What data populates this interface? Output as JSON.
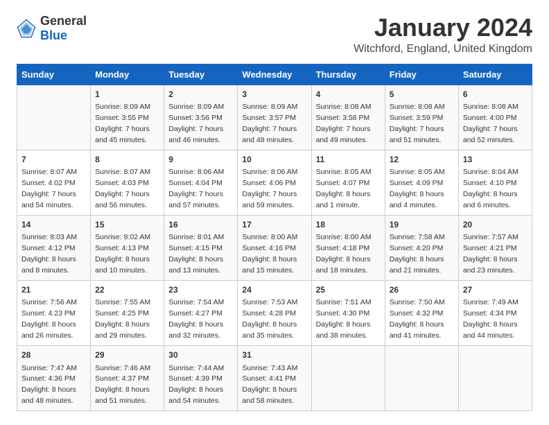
{
  "logo": {
    "general": "General",
    "blue": "Blue"
  },
  "title": "January 2024",
  "subtitle": "Witchford, England, United Kingdom",
  "days_of_week": [
    "Sunday",
    "Monday",
    "Tuesday",
    "Wednesday",
    "Thursday",
    "Friday",
    "Saturday"
  ],
  "weeks": [
    [
      {
        "day": "",
        "info": ""
      },
      {
        "day": "1",
        "info": "Sunrise: 8:09 AM\nSunset: 3:55 PM\nDaylight: 7 hours\nand 45 minutes."
      },
      {
        "day": "2",
        "info": "Sunrise: 8:09 AM\nSunset: 3:56 PM\nDaylight: 7 hours\nand 46 minutes."
      },
      {
        "day": "3",
        "info": "Sunrise: 8:09 AM\nSunset: 3:57 PM\nDaylight: 7 hours\nand 48 minutes."
      },
      {
        "day": "4",
        "info": "Sunrise: 8:08 AM\nSunset: 3:58 PM\nDaylight: 7 hours\nand 49 minutes."
      },
      {
        "day": "5",
        "info": "Sunrise: 8:08 AM\nSunset: 3:59 PM\nDaylight: 7 hours\nand 51 minutes."
      },
      {
        "day": "6",
        "info": "Sunrise: 8:08 AM\nSunset: 4:00 PM\nDaylight: 7 hours\nand 52 minutes."
      }
    ],
    [
      {
        "day": "7",
        "info": "Sunrise: 8:07 AM\nSunset: 4:02 PM\nDaylight: 7 hours\nand 54 minutes."
      },
      {
        "day": "8",
        "info": "Sunrise: 8:07 AM\nSunset: 4:03 PM\nDaylight: 7 hours\nand 56 minutes."
      },
      {
        "day": "9",
        "info": "Sunrise: 8:06 AM\nSunset: 4:04 PM\nDaylight: 7 hours\nand 57 minutes."
      },
      {
        "day": "10",
        "info": "Sunrise: 8:06 AM\nSunset: 4:06 PM\nDaylight: 7 hours\nand 59 minutes."
      },
      {
        "day": "11",
        "info": "Sunrise: 8:05 AM\nSunset: 4:07 PM\nDaylight: 8 hours\nand 1 minute."
      },
      {
        "day": "12",
        "info": "Sunrise: 8:05 AM\nSunset: 4:09 PM\nDaylight: 8 hours\nand 4 minutes."
      },
      {
        "day": "13",
        "info": "Sunrise: 8:04 AM\nSunset: 4:10 PM\nDaylight: 8 hours\nand 6 minutes."
      }
    ],
    [
      {
        "day": "14",
        "info": "Sunrise: 8:03 AM\nSunset: 4:12 PM\nDaylight: 8 hours\nand 8 minutes."
      },
      {
        "day": "15",
        "info": "Sunrise: 8:02 AM\nSunset: 4:13 PM\nDaylight: 8 hours\nand 10 minutes."
      },
      {
        "day": "16",
        "info": "Sunrise: 8:01 AM\nSunset: 4:15 PM\nDaylight: 8 hours\nand 13 minutes."
      },
      {
        "day": "17",
        "info": "Sunrise: 8:00 AM\nSunset: 4:16 PM\nDaylight: 8 hours\nand 15 minutes."
      },
      {
        "day": "18",
        "info": "Sunrise: 8:00 AM\nSunset: 4:18 PM\nDaylight: 8 hours\nand 18 minutes."
      },
      {
        "day": "19",
        "info": "Sunrise: 7:58 AM\nSunset: 4:20 PM\nDaylight: 8 hours\nand 21 minutes."
      },
      {
        "day": "20",
        "info": "Sunrise: 7:57 AM\nSunset: 4:21 PM\nDaylight: 8 hours\nand 23 minutes."
      }
    ],
    [
      {
        "day": "21",
        "info": "Sunrise: 7:56 AM\nSunset: 4:23 PM\nDaylight: 8 hours\nand 26 minutes."
      },
      {
        "day": "22",
        "info": "Sunrise: 7:55 AM\nSunset: 4:25 PM\nDaylight: 8 hours\nand 29 minutes."
      },
      {
        "day": "23",
        "info": "Sunrise: 7:54 AM\nSunset: 4:27 PM\nDaylight: 8 hours\nand 32 minutes."
      },
      {
        "day": "24",
        "info": "Sunrise: 7:53 AM\nSunset: 4:28 PM\nDaylight: 8 hours\nand 35 minutes."
      },
      {
        "day": "25",
        "info": "Sunrise: 7:51 AM\nSunset: 4:30 PM\nDaylight: 8 hours\nand 38 minutes."
      },
      {
        "day": "26",
        "info": "Sunrise: 7:50 AM\nSunset: 4:32 PM\nDaylight: 8 hours\nand 41 minutes."
      },
      {
        "day": "27",
        "info": "Sunrise: 7:49 AM\nSunset: 4:34 PM\nDaylight: 8 hours\nand 44 minutes."
      }
    ],
    [
      {
        "day": "28",
        "info": "Sunrise: 7:47 AM\nSunset: 4:36 PM\nDaylight: 8 hours\nand 48 minutes."
      },
      {
        "day": "29",
        "info": "Sunrise: 7:46 AM\nSunset: 4:37 PM\nDaylight: 8 hours\nand 51 minutes."
      },
      {
        "day": "30",
        "info": "Sunrise: 7:44 AM\nSunset: 4:39 PM\nDaylight: 8 hours\nand 54 minutes."
      },
      {
        "day": "31",
        "info": "Sunrise: 7:43 AM\nSunset: 4:41 PM\nDaylight: 8 hours\nand 58 minutes."
      },
      {
        "day": "",
        "info": ""
      },
      {
        "day": "",
        "info": ""
      },
      {
        "day": "",
        "info": ""
      }
    ]
  ]
}
